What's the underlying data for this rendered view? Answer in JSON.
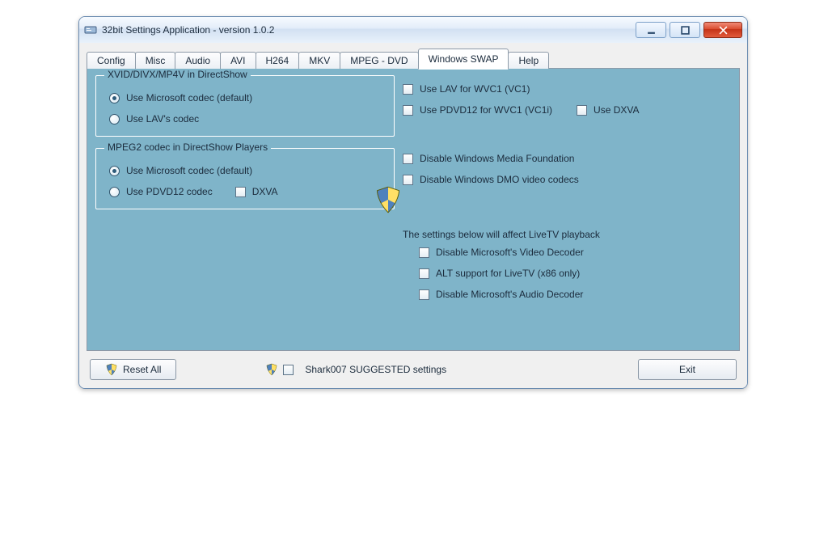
{
  "window": {
    "title": "32bit Settings Application - version 1.0.2"
  },
  "tabs": [
    "Config",
    "Misc",
    "Audio",
    "AVI",
    "H264",
    "MKV",
    "MPEG - DVD",
    "Windows SWAP",
    "Help"
  ],
  "active_tab_index": 7,
  "group1": {
    "legend": "XVID/DIVX/MP4V in DirectShow",
    "opt_ms": "Use Microsoft codec (default)",
    "opt_lav": "Use LAV's codec"
  },
  "group2": {
    "legend": "MPEG2 codec in DirectShow Players",
    "opt_ms": "Use Microsoft codec (default)",
    "opt_pdvd": "Use PDVD12 codec",
    "dxva": "DXVA"
  },
  "right": {
    "lav_wvc1": "Use LAV for WVC1 (VC1)",
    "pdvd_wvc1": "Use PDVD12 for WVC1 (VC1i)",
    "use_dxva": "Use DXVA",
    "disable_wmf": "Disable Windows Media Foundation",
    "disable_dmo": "Disable Windows DMO video codecs",
    "livetv_info": "The settings below will affect LiveTV playback",
    "disable_vdec": "Disable Microsoft's Video Decoder",
    "alt_livetv": "ALT support for LiveTV (x86 only)",
    "disable_adec": "Disable Microsoft's Audio Decoder"
  },
  "footer": {
    "reset": "Reset All",
    "suggested": "Shark007 SUGGESTED settings",
    "exit": "Exit"
  }
}
